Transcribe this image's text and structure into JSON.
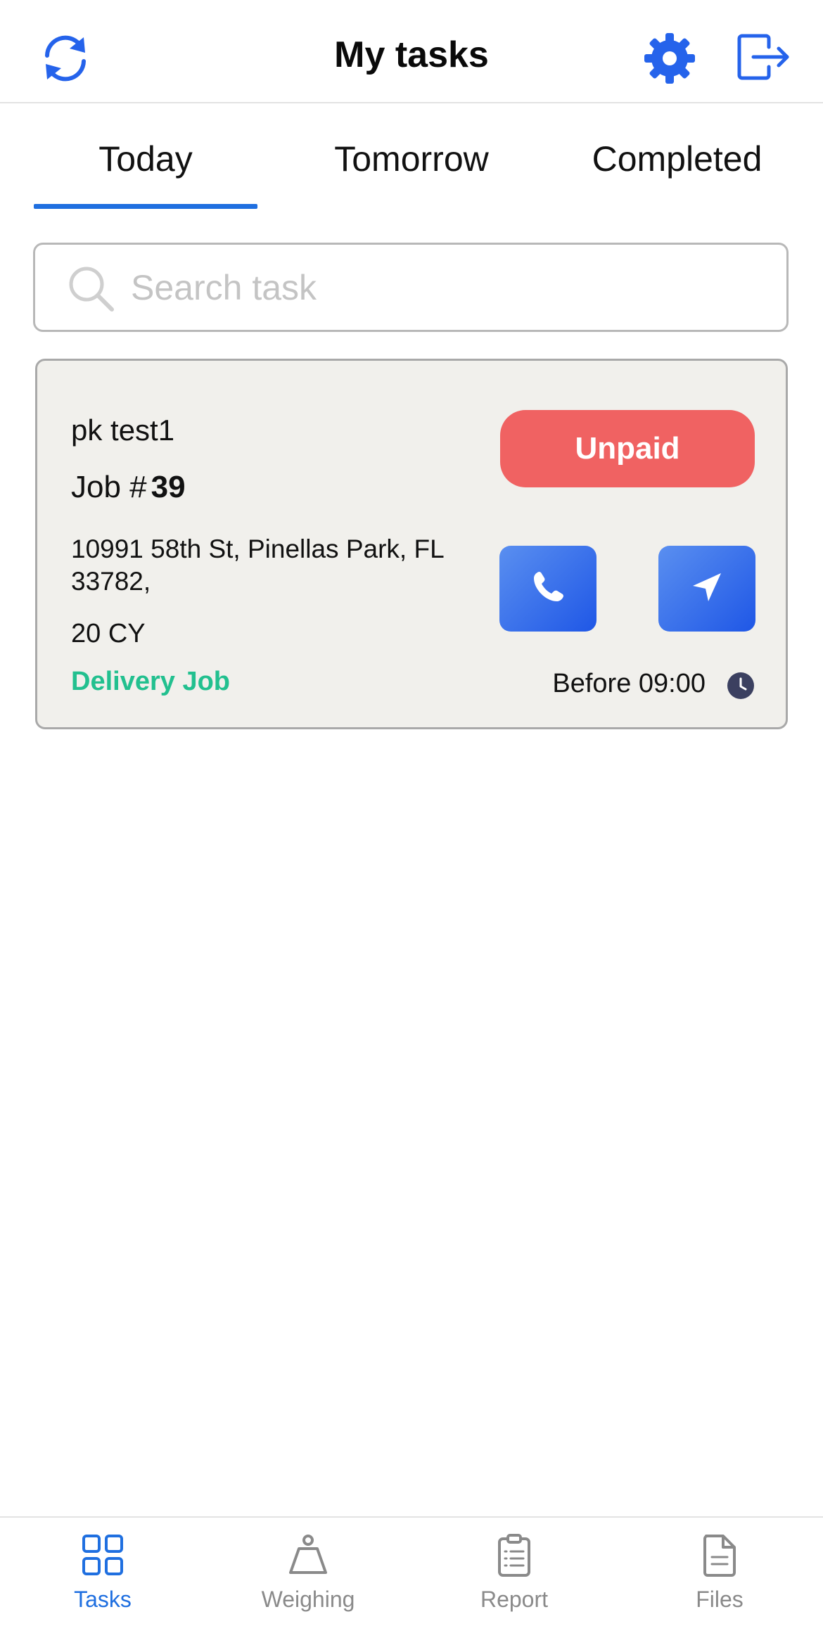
{
  "header": {
    "title": "My tasks",
    "icons": {
      "left": "refresh-icon",
      "right1": "gear-icon",
      "right2": "logout-icon"
    },
    "accent": "#1f6fe0"
  },
  "tabs": [
    {
      "label": "Today",
      "active": true
    },
    {
      "label": "Tomorrow",
      "active": false
    },
    {
      "label": "Completed",
      "active": false
    }
  ],
  "search": {
    "placeholder": "Search task",
    "value": ""
  },
  "tasks": [
    {
      "customer": "pk test1",
      "job_prefix": "Job #",
      "job_number": "39",
      "address": "10991 58th St, Pinellas Park, FL 33782,",
      "volume": "20 CY",
      "job_type": "Delivery Job",
      "payment_status": "Unpaid",
      "time": "Before 09:00",
      "colors": {
        "status": "#f06262",
        "job_type": "#22c08f",
        "action": "#1f57e6"
      }
    }
  ],
  "bottom_nav": [
    {
      "label": "Tasks",
      "icon": "grid-icon",
      "active": true
    },
    {
      "label": "Weighing",
      "icon": "weight-icon",
      "active": false
    },
    {
      "label": "Report",
      "icon": "clipboard-icon",
      "active": false
    },
    {
      "label": "Files",
      "icon": "file-icon",
      "active": false
    }
  ]
}
